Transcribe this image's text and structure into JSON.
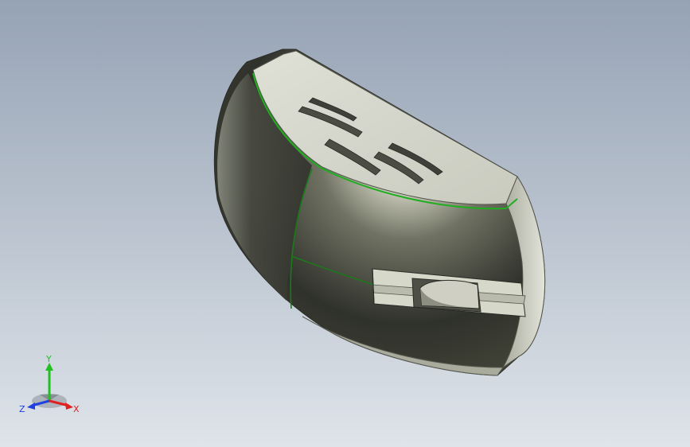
{
  "colors": {
    "background_top": "#96a3b5",
    "background_bottom": "#dfe4ea",
    "edge_highlight": "#1fae1f",
    "axis_x": "#e02020",
    "axis_y": "#20c020",
    "axis_z": "#2040e0"
  },
  "model": {
    "icon": "3d-part-icon"
  },
  "triad": {
    "x_label": "X",
    "y_label": "Y",
    "z_label": "Z"
  }
}
